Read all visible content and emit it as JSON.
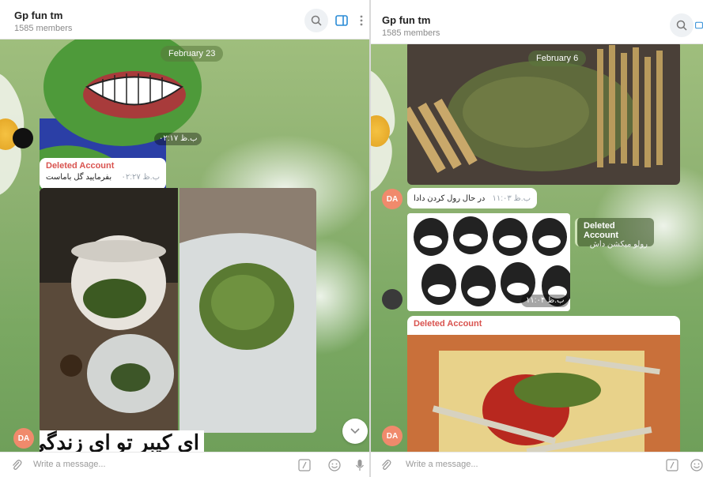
{
  "left": {
    "header": {
      "title": "Gp fun tm",
      "subtitle": "1585 members"
    },
    "date_pill": "February 23",
    "sticker_time": "ب.ظ ۰۲:۱۷",
    "message1": {
      "sender": "Deleted Account",
      "text": "بفرمایید گل باماست",
      "time": "ب.ظ ۰۲:۲۷"
    },
    "avatar_initials": "DA",
    "caption_text": "ای کیبر تو ای زندگی",
    "input_placeholder": "Write a message..."
  },
  "right": {
    "header": {
      "title": "Gp fun tm",
      "subtitle": "1585 members"
    },
    "date_pill": "February 6",
    "message1": {
      "text": "در حال رول کردن دادا",
      "time": "ب.ظ ۱۱:۰۳"
    },
    "reply": {
      "sender": "Deleted Account",
      "text": "رولو میکشن داش"
    },
    "meme_time": "ب.ظ ۱۱:۰۴",
    "message2": {
      "sender": "Deleted Account"
    },
    "avatar_initials": "DA",
    "input_placeholder": "Write a message..."
  },
  "colors": {
    "accent": "#2a8bd6",
    "avatar": "#f08a6c",
    "sender": "#d9534f"
  }
}
